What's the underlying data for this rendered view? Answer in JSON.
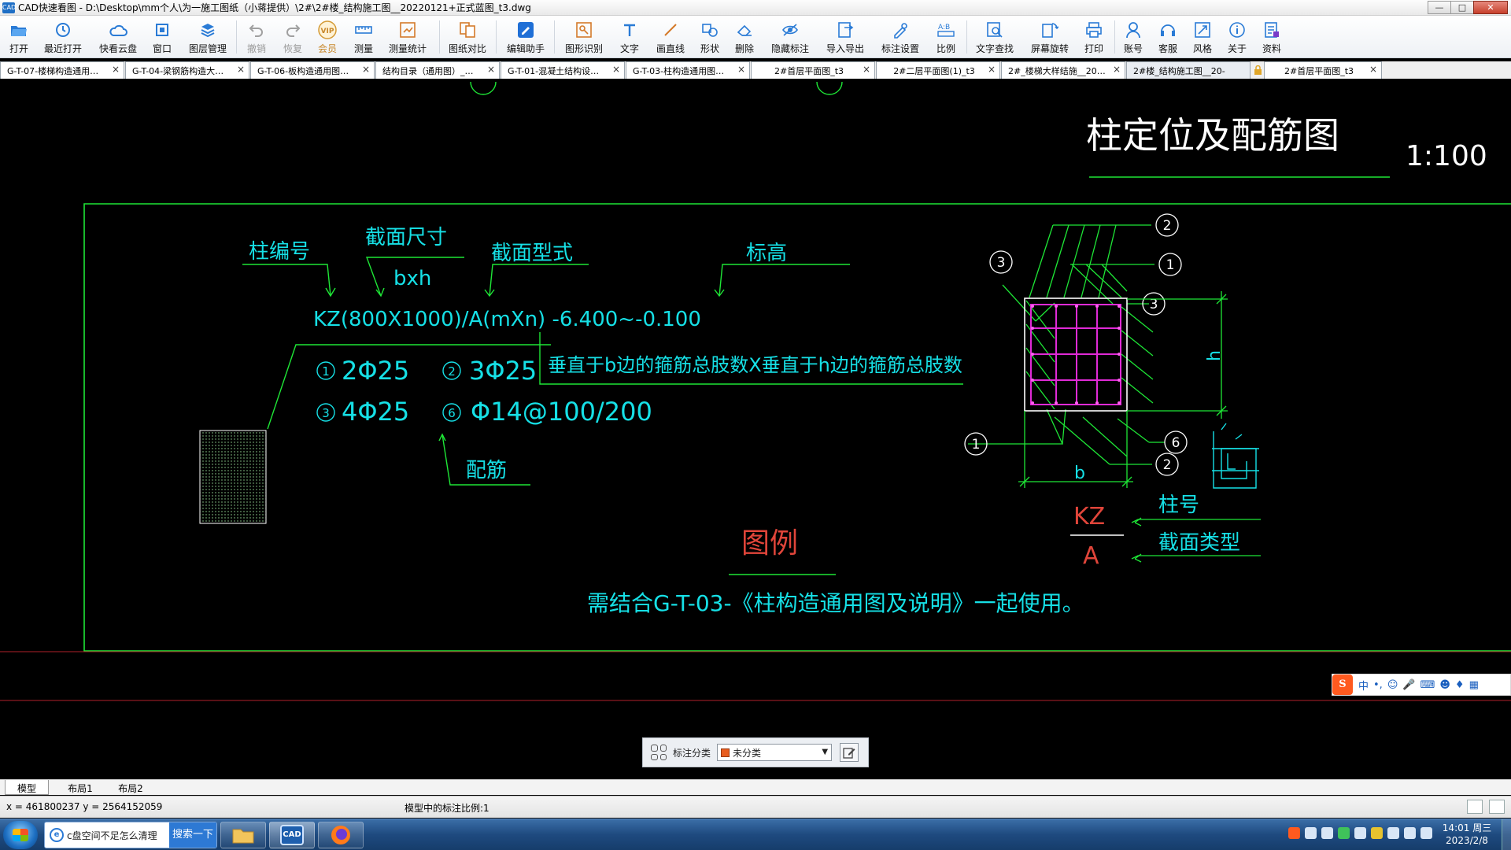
{
  "window": {
    "title": "CAD快速看图 - D:\\Desktop\\mm个人\\为一施工图纸（小蒋提供）\\2#\\2#楼_结构施工图__20220121+正式蓝图_t3.dwg",
    "app_icon": "CAD"
  },
  "toolbar": {
    "items": [
      {
        "label": "打开",
        "icon": "folder-open-icon"
      },
      {
        "label": "最近打开",
        "icon": "recent-clock-icon"
      },
      {
        "label": "快看云盘",
        "icon": "cloud-icon"
      },
      {
        "label": "窗口",
        "icon": "window-icon"
      },
      {
        "label": "图层管理",
        "icon": "layers-icon"
      },
      {
        "label": "撤销",
        "icon": "undo-icon",
        "disabled": true
      },
      {
        "label": "恢复",
        "icon": "redo-icon",
        "disabled": true
      },
      {
        "label": "会员",
        "icon": "vip-icon",
        "badge": "VIP"
      },
      {
        "label": "测量",
        "icon": "ruler-icon"
      },
      {
        "label": "测量统计",
        "icon": "measure-stats-icon"
      },
      {
        "label": "图纸对比",
        "icon": "compare-icon"
      },
      {
        "label": "编辑助手",
        "icon": "edit-assistant-icon"
      },
      {
        "label": "图形识别",
        "icon": "shape-recognize-icon"
      },
      {
        "label": "文字",
        "icon": "text-icon"
      },
      {
        "label": "画直线",
        "icon": "line-icon"
      },
      {
        "label": "形状",
        "icon": "shape-icon"
      },
      {
        "label": "删除",
        "icon": "eraser-icon"
      },
      {
        "label": "隐藏标注",
        "icon": "hide-annotation-icon"
      },
      {
        "label": "导入导出",
        "icon": "import-export-icon"
      },
      {
        "label": "标注设置",
        "icon": "annotation-settings-icon"
      },
      {
        "label": "比例",
        "icon": "scale-icon"
      },
      {
        "label": "文字查找",
        "icon": "text-search-icon"
      },
      {
        "label": "屏幕旋转",
        "icon": "rotate-screen-icon"
      },
      {
        "label": "打印",
        "icon": "printer-icon"
      },
      {
        "label": "账号",
        "icon": "account-icon"
      },
      {
        "label": "客服",
        "icon": "headset-icon"
      },
      {
        "label": "风格",
        "icon": "style-icon"
      },
      {
        "label": "关于",
        "icon": "info-icon"
      },
      {
        "label": "资料",
        "icon": "documents-icon"
      }
    ]
  },
  "tabs": [
    {
      "label": "G-T-07-楼梯构造通用…"
    },
    {
      "label": "G-T-04-梁钢筋构造大…"
    },
    {
      "label": "G-T-06-板构造通用图…"
    },
    {
      "label": "结构目录（通用图）_…"
    },
    {
      "label": "G-T-01-混凝土结构设…"
    },
    {
      "label": "G-T-03-柱构造通用图…"
    },
    {
      "label": "2#首层平面图_t3"
    },
    {
      "label": "2#二层平面图(1)_t3"
    },
    {
      "label": "2#_楼梯大样结施__20…"
    },
    {
      "label": "2#楼_结构施工图__20-",
      "active": true,
      "locked": true
    },
    {
      "label": "2#首层平面图_t3"
    }
  ],
  "drawing": {
    "title": "柱定位及配筋图",
    "scale": "1:100",
    "label_column_no": "柱编号",
    "label_section_size": "截面尺寸",
    "label_bxh": "bxh",
    "label_section_type": "截面型式",
    "label_elevation": "标高",
    "formula": "KZ(800X1000)/A(mXn) -6.400~-0.100",
    "note_stirrups": "垂直于b边的箍筋总肢数X垂直于h边的箍筋总肢数",
    "rebar_1": "2Φ25",
    "rebar_2": "3Φ25",
    "rebar_3": "4Φ25",
    "rebar_6": "Φ14@100/200",
    "label_reinforcement": "配筋",
    "legend_title": "图例",
    "legend_note": "需结合G-T-03-《柱构造通用图及说明》一起使用。",
    "kz": "KZ",
    "a": "A",
    "label_column_num": "柱号",
    "label_section_kind": "截面类型",
    "dim_b": "b",
    "dim_h": "h",
    "callout_1": "1",
    "callout_2": "2",
    "callout_3": "3",
    "callout_6": "6"
  },
  "annotation_panel": {
    "label": "标注分类",
    "value": "未分类",
    "swatch_color": "#e85d1f"
  },
  "ime": {
    "items": [
      "中",
      "•,",
      "☺",
      "🎤",
      "⌨"
    ]
  },
  "layout_tabs": [
    {
      "label": "模型",
      "active": true
    },
    {
      "label": "布局1"
    },
    {
      "label": "布局2"
    }
  ],
  "status": {
    "coords": "x = 461800237  y = 2564152059",
    "model_scale": "模型中的标注比例:1"
  },
  "taskbar": {
    "search_text": "c盘空间不足怎么清理",
    "search_button": "搜索一下",
    "time": "14:01 周三",
    "date": "2023/2/8"
  },
  "colors": {
    "cyan": "#16e0e6",
    "green": "#1ee636",
    "magenta": "#e02ad6",
    "red": "#e0453a",
    "white": "#ffffff"
  }
}
